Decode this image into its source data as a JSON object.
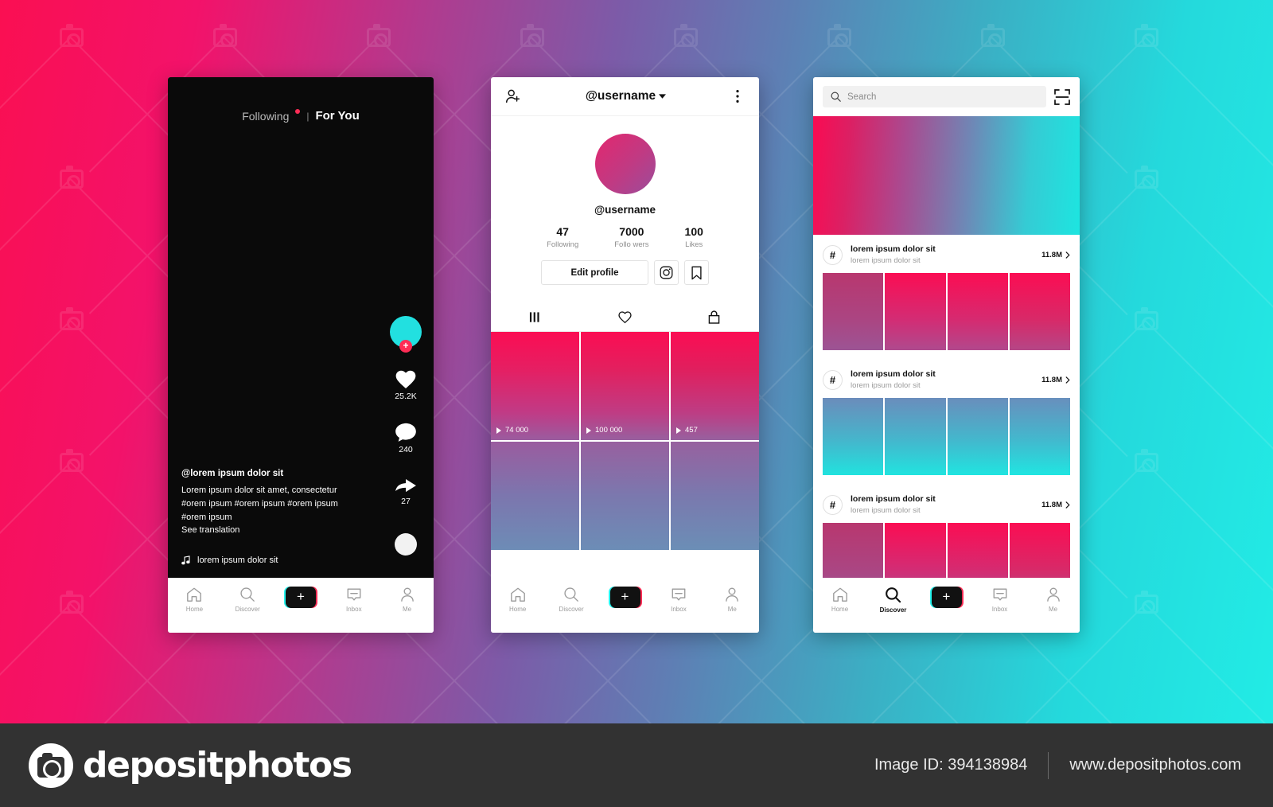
{
  "background": {
    "left_color": "#FA0F52",
    "right_color": "#22EDE6"
  },
  "footer": {
    "brand": "depositphotos",
    "image_id_label": "Image ID: 394138984",
    "website": "www.depositphotos.com",
    "logo_icon": "camera-icon"
  },
  "phone_feed": {
    "tabs": {
      "following": "Following",
      "separator": "|",
      "for_you": "For You",
      "dot_color": "#FE2C55"
    },
    "rail": {
      "avatar_icon": "avatar-circle",
      "follow_plus": "+",
      "like_icon": "heart-icon",
      "like_count": "25.2K",
      "comment_icon": "comment-icon",
      "comment_count": "240",
      "share_icon": "share-arrow-icon",
      "share_count": "27",
      "disc_icon": "music-disc-icon"
    },
    "caption": {
      "username": "@lorem ipsum dolor sit",
      "line1": "Lorem ipsum dolor sit amet, consectetur",
      "line2": "#orem ipsum #orem ipsum #orem ipsum",
      "line3": "#orem ipsum",
      "translate": "See translation"
    },
    "music": {
      "icon": "music-note-icon",
      "title": "lorem ipsum dolor sit"
    },
    "nav": {
      "items": [
        {
          "label": "Home",
          "icon": "home-icon",
          "active": false
        },
        {
          "label": "Discover",
          "icon": "search-icon",
          "active": false
        },
        {
          "label": "",
          "icon": "create-plus-icon",
          "active": false
        },
        {
          "label": "Inbox",
          "icon": "inbox-icon",
          "active": false
        },
        {
          "label": "Me",
          "icon": "person-icon",
          "active": false
        }
      ]
    }
  },
  "phone_profile": {
    "header": {
      "add_friend_icon": "add-person-icon",
      "title": "@username",
      "dropdown_icon": "chevron-down-icon",
      "more_icon": "three-dots-icon"
    },
    "avatar_icon": "profile-avatar",
    "username": "@username",
    "stats": [
      {
        "value": "47",
        "label": "Following"
      },
      {
        "value": "7000",
        "label": "Follo wers"
      },
      {
        "value": "100",
        "label": "Likes"
      }
    ],
    "edit_button": "Edit profile",
    "instagram_icon": "instagram-icon",
    "bookmark_icon": "bookmark-icon",
    "tabs": [
      {
        "icon": "grid-icon",
        "active": true
      },
      {
        "icon": "heart-outline-icon",
        "active": false
      },
      {
        "icon": "lock-icon",
        "active": false
      }
    ],
    "grid": [
      {
        "play_icon": "play-icon",
        "views": "74 000"
      },
      {
        "play_icon": "play-icon",
        "views": "100 000"
      },
      {
        "play_icon": "play-icon",
        "views": "457"
      },
      {
        "play_icon": "play-icon",
        "views": ""
      },
      {
        "play_icon": "play-icon",
        "views": ""
      },
      {
        "play_icon": "play-icon",
        "views": ""
      }
    ],
    "nav": {
      "items": [
        {
          "label": "Home",
          "icon": "home-icon",
          "active": false
        },
        {
          "label": "Discover",
          "icon": "search-icon",
          "active": false
        },
        {
          "label": "",
          "icon": "create-plus-icon",
          "active": false
        },
        {
          "label": "Inbox",
          "icon": "inbox-icon",
          "active": false
        },
        {
          "label": "Me",
          "icon": "person-icon",
          "active": false
        }
      ]
    }
  },
  "phone_discover": {
    "search": {
      "icon": "search-icon",
      "placeholder": "Search",
      "value": "",
      "scan_icon": "scan-qr-icon"
    },
    "banner_icon": "banner-image",
    "sections": [
      {
        "hash_icon": "hashtag-icon",
        "title": "lorem ipsum dolor sit",
        "subtitle": "lorem ipsum dolor sit",
        "count": "11.8M",
        "chevron_icon": "chevron-right-icon",
        "theme": "pink"
      },
      {
        "hash_icon": "hashtag-icon",
        "title": "lorem ipsum dolor sit",
        "subtitle": "lorem ipsum dolor sit",
        "count": "11.8M",
        "chevron_icon": "chevron-right-icon",
        "theme": "cyan"
      },
      {
        "hash_icon": "hashtag-icon",
        "title": "lorem ipsum dolor sit",
        "subtitle": "lorem ipsum dolor sit",
        "count": "11.8M",
        "chevron_icon": "chevron-right-icon",
        "theme": "pink"
      }
    ],
    "nav": {
      "items": [
        {
          "label": "Home",
          "icon": "home-icon",
          "active": false
        },
        {
          "label": "Discover",
          "icon": "search-icon",
          "active": true
        },
        {
          "label": "",
          "icon": "create-plus-icon",
          "active": false
        },
        {
          "label": "Inbox",
          "icon": "inbox-icon",
          "active": false
        },
        {
          "label": "Me",
          "icon": "person-icon",
          "active": false
        }
      ]
    }
  }
}
